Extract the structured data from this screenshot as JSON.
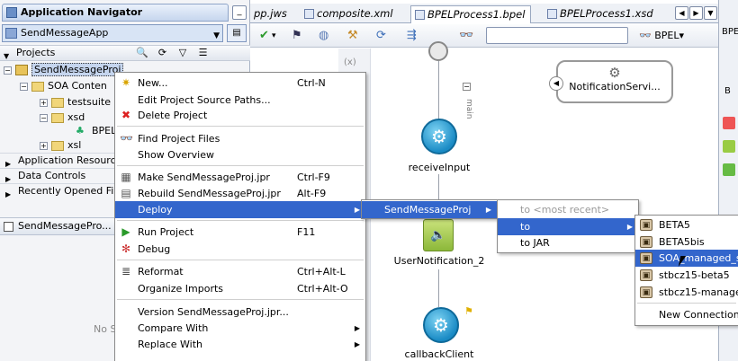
{
  "navigator": {
    "title": "Application Navigator",
    "app_name": "SendMessageApp",
    "projects_label": "Projects",
    "tree": {
      "project": "SendMessageProj",
      "soa_content": "SOA Conten",
      "testsuite": "testsuite",
      "xsd": "xsd",
      "bpel": "BPEL",
      "xsl": "xsl"
    },
    "sections": [
      "Application Resourc",
      "Data Controls",
      "Recently Opened File"
    ],
    "structure_title": "SendMessagePro...",
    "no_structure": "No S"
  },
  "tabs": [
    {
      "label": "pp.jws"
    },
    {
      "label": "composite.xml"
    },
    {
      "label": "BPELProcess1.bpel"
    },
    {
      "label": "BPELProcess1.xsd"
    }
  ],
  "toolbar": {
    "bpel_label": "BPEL"
  },
  "canvas": {
    "main_label": "main",
    "receive_label": "receiveInput",
    "user_notification_label": "UserNotification_2",
    "callback_label": "callbackClient",
    "notification_service_label": "NotificationServi..."
  },
  "context_menu": [
    {
      "label": "New...",
      "shortcut": "Ctrl-N",
      "icon": "new-icon"
    },
    {
      "label": "Edit Project Source Paths...",
      "shortcut": "",
      "icon": ""
    },
    {
      "label": "Delete Project",
      "shortcut": "",
      "icon": "delete-icon"
    },
    {
      "label": "Find Project Files",
      "shortcut": "",
      "icon": "binoculars-icon"
    },
    {
      "label": "Show Overview",
      "shortcut": "",
      "icon": ""
    },
    {
      "label": "Make SendMessageProj.jpr",
      "shortcut": "Ctrl-F9",
      "icon": "make-icon"
    },
    {
      "label": "Rebuild SendMessageProj.jpr",
      "shortcut": "Alt-F9",
      "icon": "rebuild-icon"
    },
    {
      "label": "Deploy",
      "shortcut": "",
      "icon": ""
    },
    {
      "label": "Run Project",
      "shortcut": "F11",
      "icon": "run-icon"
    },
    {
      "label": "Debug",
      "shortcut": "",
      "icon": "debug-icon"
    },
    {
      "label": "Reformat",
      "shortcut": "Ctrl+Alt-L",
      "icon": "reformat-icon"
    },
    {
      "label": "Organize Imports",
      "shortcut": "Ctrl+Alt-O",
      "icon": ""
    },
    {
      "label": "Version SendMessageProj.jpr...",
      "shortcut": "",
      "icon": ""
    },
    {
      "label": "Compare With",
      "shortcut": "",
      "icon": ""
    },
    {
      "label": "Replace With",
      "shortcut": "",
      "icon": ""
    }
  ],
  "deploy_menu": {
    "item": "SendMessageProj"
  },
  "target_menu": [
    "to <most recent>",
    "to",
    "to JAR"
  ],
  "servers_menu": [
    "BETA5",
    "BETA5bis",
    "SOA_managed_s",
    "stbcz15-beta5",
    "stbcz15-manage",
    "New Connection..."
  ],
  "right_pane": {
    "label_a": "BPE",
    "label_b": "B"
  }
}
